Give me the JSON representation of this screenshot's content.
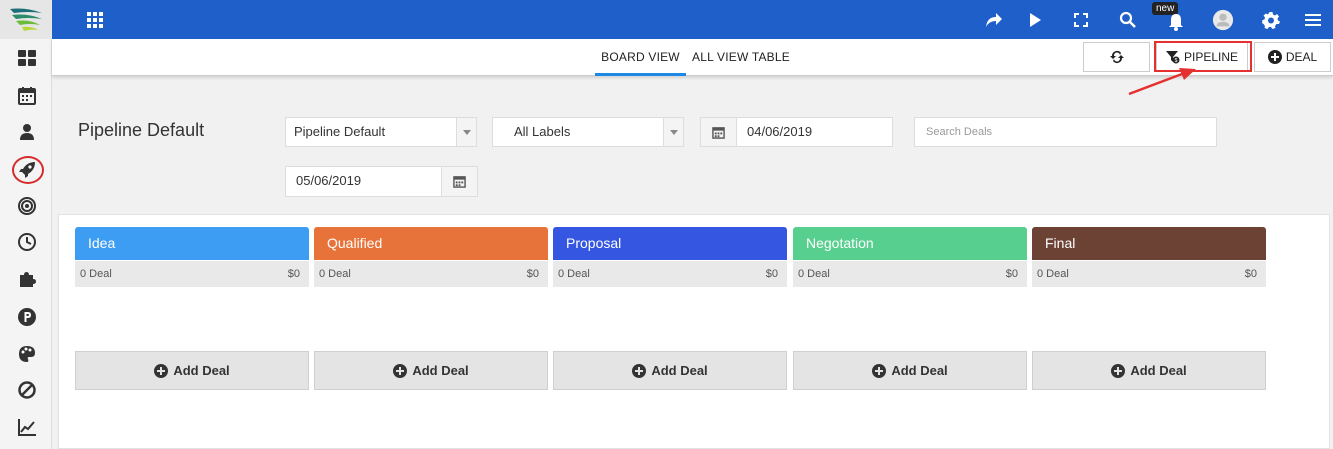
{
  "topbar": {
    "new_badge": "new",
    "icons": [
      "apps-grid-icon",
      "share-icon",
      "play-icon",
      "fullscreen-icon",
      "search-icon",
      "bell-icon",
      "user-avatar-icon",
      "gear-icon",
      "menu-icon"
    ]
  },
  "sidebar": {
    "icons": [
      "dashboard-icon",
      "calendar-icon",
      "contact-icon",
      "rocket-icon",
      "target-icon",
      "clock-icon",
      "puzzle-icon",
      "p-circle-icon",
      "palette-icon",
      "block-icon",
      "chart-line-icon"
    ]
  },
  "subheader": {
    "tabs": [
      {
        "label": "BOARD VIEW",
        "active": true
      },
      {
        "label": "ALL VIEW TABLE",
        "active": false
      }
    ],
    "pipeline_label": "PIPELINE",
    "deal_label": "DEAL"
  },
  "filters": {
    "title": "Pipeline Default",
    "pipeline_select": "Pipeline Default",
    "labels_select": "All Labels",
    "start_date": "04/06/2019",
    "end_date": "05/06/2019",
    "search_placeholder": "Search Deals"
  },
  "board": {
    "add_label": "Add Deal",
    "columns": [
      {
        "name": "Idea",
        "color": "#3d9df2",
        "count": "0 Deal",
        "amount": "$0"
      },
      {
        "name": "Qualified",
        "color": "#e8733a",
        "count": "0 Deal",
        "amount": "$0"
      },
      {
        "name": "Proposal",
        "color": "#3556e0",
        "count": "0 Deal",
        "amount": "$0"
      },
      {
        "name": "Negotation",
        "color": "#57cf8e",
        "count": "0 Deal",
        "amount": "$0"
      },
      {
        "name": "Final",
        "color": "#6b4234",
        "count": "0 Deal",
        "amount": "$0"
      }
    ]
  },
  "colors": {
    "topbar": "#1e5fc9",
    "highlight": "#e53030"
  }
}
